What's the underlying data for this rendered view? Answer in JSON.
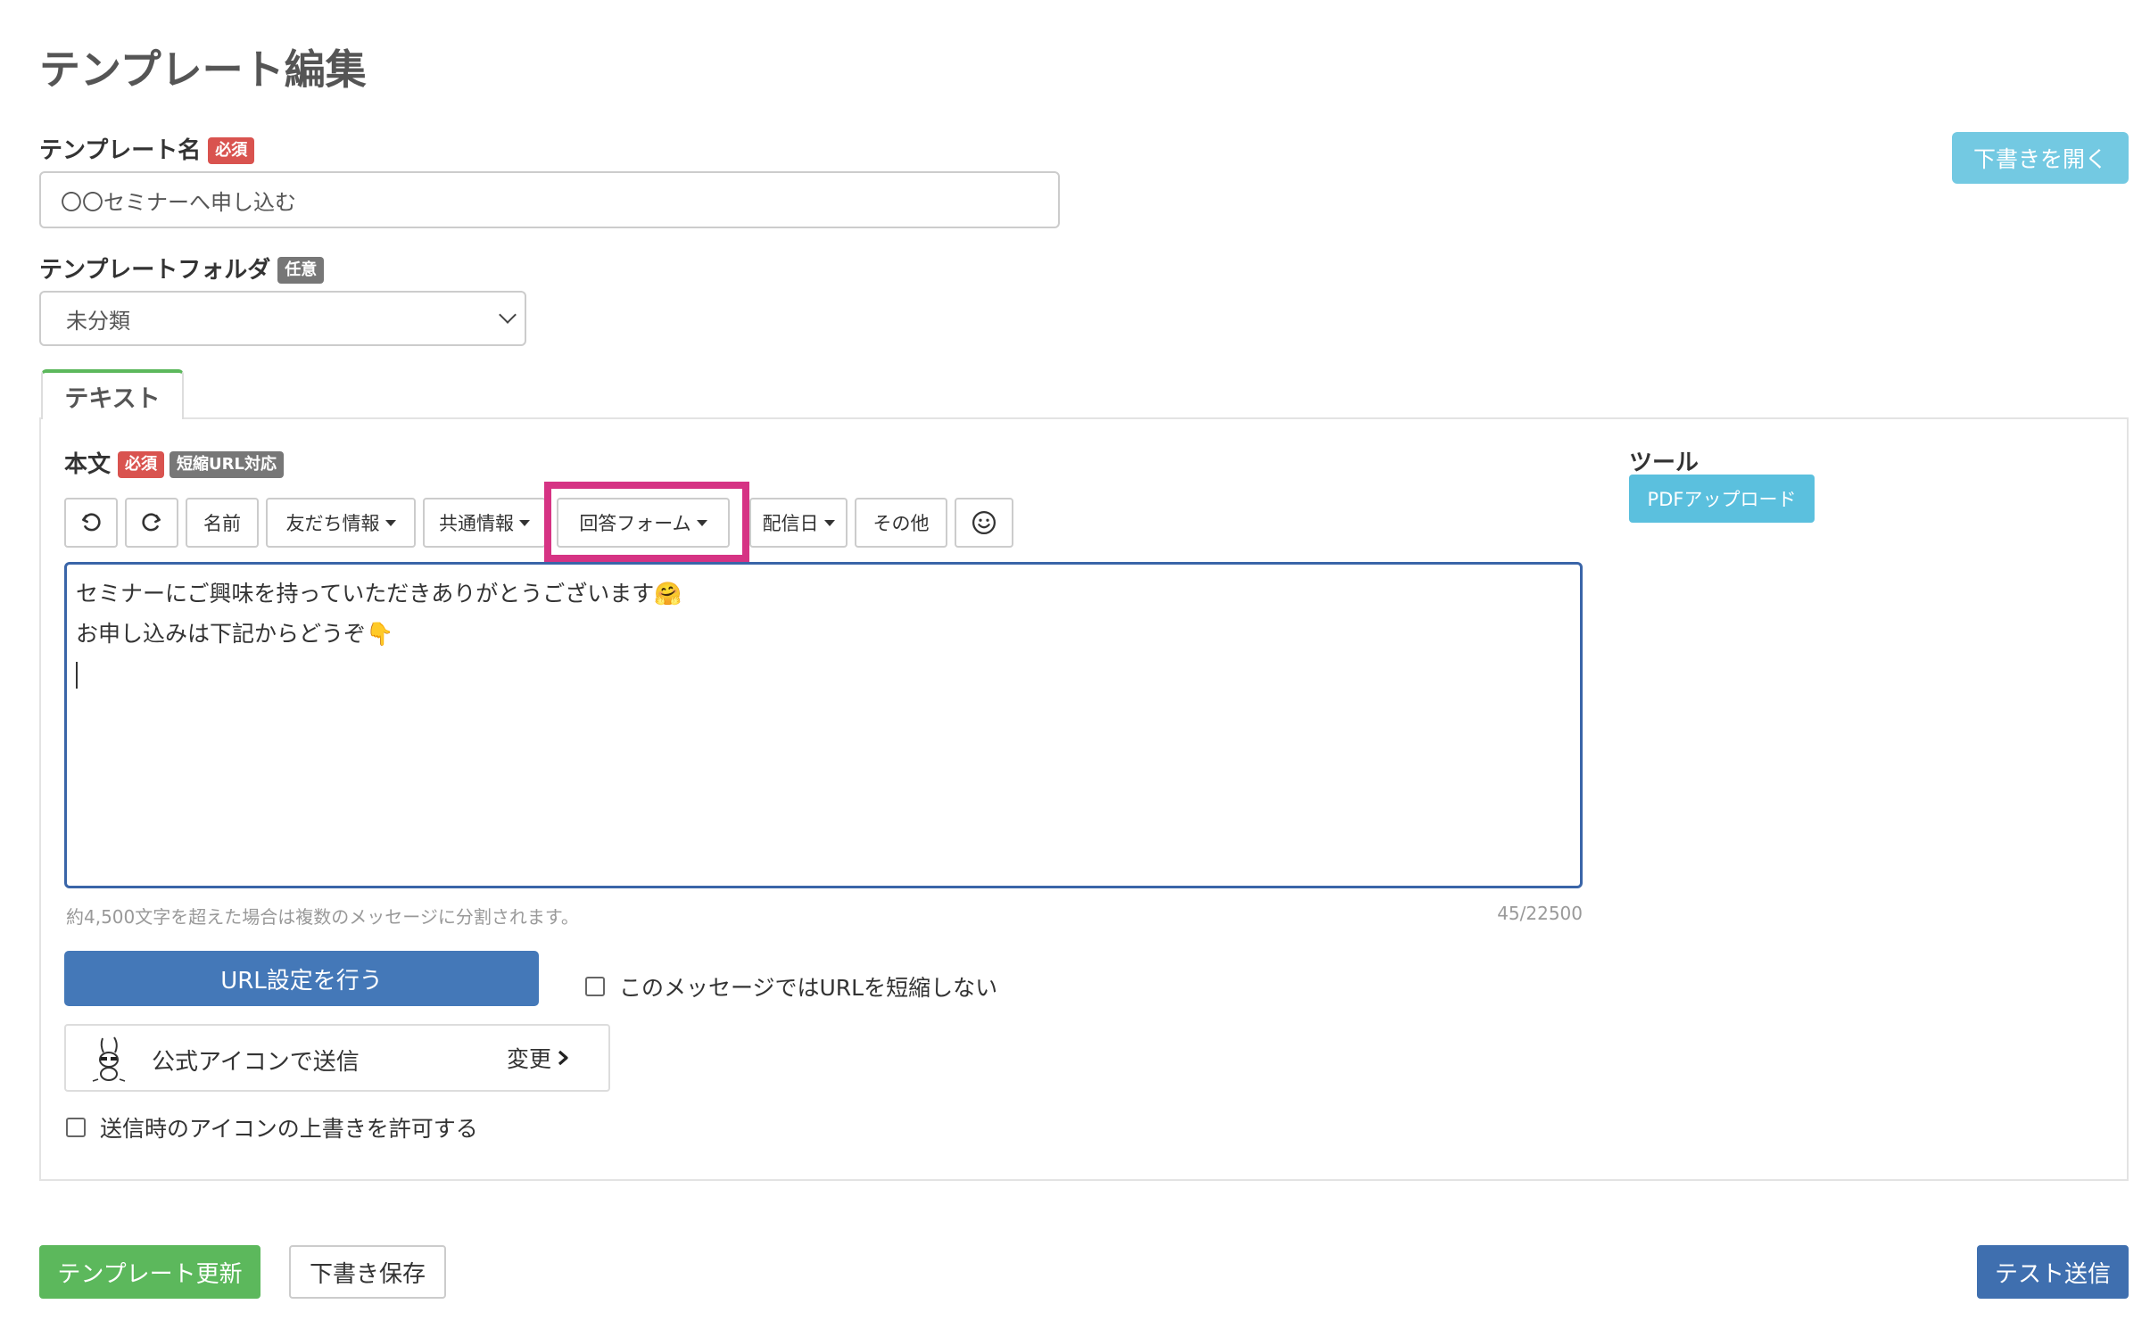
{
  "page": {
    "title": "テンプレート編集"
  },
  "template_name": {
    "label": "テンプレート名",
    "badge": "必須",
    "value": "〇〇セミナーへ申し込む"
  },
  "template_folder": {
    "label": "テンプレートフォルダ",
    "badge": "任意",
    "selected": "未分類"
  },
  "draft_open_label": "下書きを開く",
  "tab": {
    "label": "テキスト"
  },
  "body": {
    "label": "本文",
    "badge_required": "必須",
    "badge_short_url": "短縮URL対応"
  },
  "toolbar": {
    "undo_icon": "undo-icon",
    "redo_icon": "redo-icon",
    "name": "名前",
    "friend_info": "友だち情報",
    "common_info": "共通情報",
    "answer_form": "回答フォーム",
    "delivery_date": "配信日",
    "other": "その他",
    "emoji_icon": "smiley-icon"
  },
  "editor": {
    "line1": "セミナーにご興味を持っていただきありがとうございます🤗",
    "line2": "お申し込みは下記からどうぞ👇"
  },
  "hint": "約4,500文字を超えた場合は複数のメッセージに分割されます。",
  "counter": "45/22500",
  "url_button": "URL設定を行う",
  "no_shorten_label": "このメッセージではURLを短縮しない",
  "send_icon": {
    "label": "公式アイコンで送信",
    "change": "変更"
  },
  "allow_override_label": "送信時のアイコンの上書きを許可する",
  "tools": {
    "title": "ツール",
    "pdf_upload": "PDFアップロード"
  },
  "footer": {
    "update": "テンプレート更新",
    "save_draft": "下書き保存",
    "test_send": "テスト送信"
  },
  "colors": {
    "required": "#d9534f",
    "optional": "#777777",
    "primary": "#4478b8",
    "success": "#5cb85c",
    "info": "#5bc0de",
    "highlight": "#d63384"
  }
}
